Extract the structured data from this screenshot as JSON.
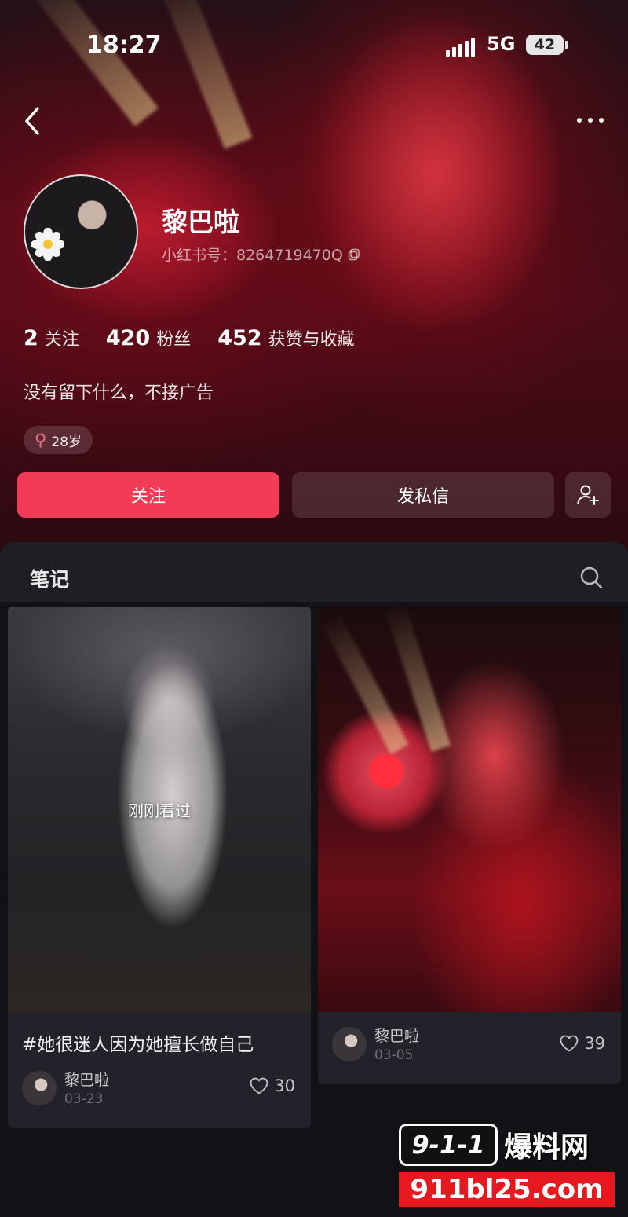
{
  "status_bar": {
    "time": "18:27",
    "network": "5G",
    "battery": "42"
  },
  "profile": {
    "name": "黎巴啦",
    "id_text": "小红书号：8264719470Q",
    "stats": [
      {
        "value": "2",
        "label": "关注"
      },
      {
        "value": "420",
        "label": "粉丝"
      },
      {
        "value": "452",
        "label": "获赞与收藏"
      }
    ],
    "bio": "没有留下什么，不接广告",
    "tag": {
      "gender_symbol": "♀",
      "age": "28岁"
    }
  },
  "actions": {
    "follow": "关注",
    "message": "发私信"
  },
  "notes": {
    "title": "笔记",
    "cards": [
      {
        "overlay": "刚刚看过",
        "title": "#她很迷人因为她擅长做自己",
        "author": "黎巴啦",
        "date": "03-23",
        "likes": "30"
      },
      {
        "author": "黎巴啦",
        "date": "03-05",
        "likes": "39"
      }
    ]
  },
  "watermark": {
    "logo": "9-1-1",
    "name": "爆料网",
    "url": "911bl25.com"
  },
  "colors": {
    "accent": "#f23b56",
    "background": "#17161b",
    "card": "#23222a"
  }
}
